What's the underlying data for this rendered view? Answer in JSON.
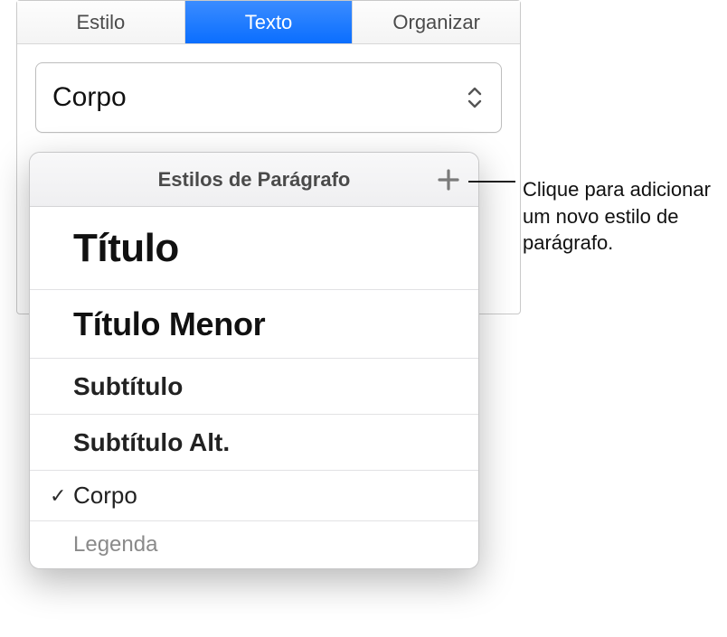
{
  "tabs": {
    "style": "Estilo",
    "text": "Texto",
    "arrange": "Organizar"
  },
  "style_select": {
    "current": "Corpo"
  },
  "popover": {
    "title": "Estilos de Parágrafo",
    "items": [
      {
        "label": "Título",
        "selected": false,
        "variant": "titulo"
      },
      {
        "label": "Título Menor",
        "selected": false,
        "variant": "titulo-menor"
      },
      {
        "label": "Subtítulo",
        "selected": false,
        "variant": "subtitulo"
      },
      {
        "label": "Subtítulo Alt.",
        "selected": false,
        "variant": "subtitulo-alt"
      },
      {
        "label": "Corpo",
        "selected": true,
        "variant": "corpo"
      },
      {
        "label": "Legenda",
        "selected": false,
        "variant": "legenda"
      }
    ]
  },
  "callout": {
    "text": "Clique para adicionar um novo estilo de parágrafo."
  }
}
